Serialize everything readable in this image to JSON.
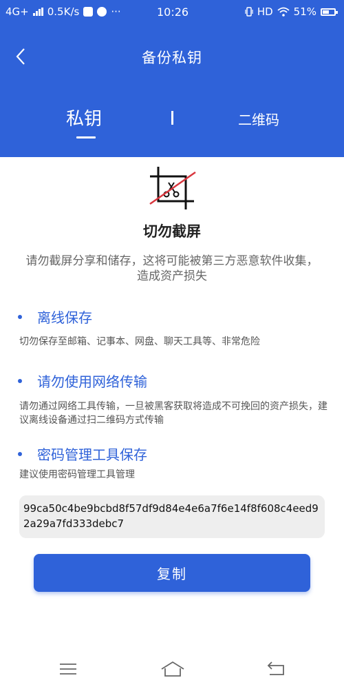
{
  "status_bar": {
    "network": "4G+",
    "speed": "0.5K/s",
    "dots": "···",
    "time": "10:26",
    "hd": "HD",
    "battery": "51%"
  },
  "header": {
    "title": "备份私钥"
  },
  "tabs": [
    {
      "label": "私钥",
      "active": true
    },
    {
      "label": "二维码",
      "active": false
    }
  ],
  "warning": {
    "title": "切勿截屏",
    "description": "请勿截屏分享和储存，这将可能被第三方恶意软件收集，造成资产损失"
  },
  "sections": [
    {
      "title": "离线保存",
      "description": "切勿保存至邮箱、记事本、网盘、聊天工具等、非常危险"
    },
    {
      "title": "请勿使用网络传输",
      "description": "请勿通过网络工具传输，一旦被黑客获取将造成不可挽回的资产损失，建议离线设备通过扫二维码方式传输"
    },
    {
      "title": "密码管理工具保存",
      "description": "建议使用密码管理工具管理"
    }
  ],
  "private_key": "99ca50c4be9bcbd8f57df9d84e4e6a7f6e14f8f608c4eed92a29a7fd333debc7",
  "copy_button": "复制",
  "icons": {
    "back": "chevron-left-icon",
    "no_screenshot": "crop-crossed-icon",
    "nav_menu": "menu-icon",
    "nav_home": "home-icon",
    "nav_back": "return-icon"
  },
  "colors": {
    "primary": "#2f62d9",
    "warning_slash": "#d9363e",
    "key_box_bg": "#eeeeee"
  }
}
